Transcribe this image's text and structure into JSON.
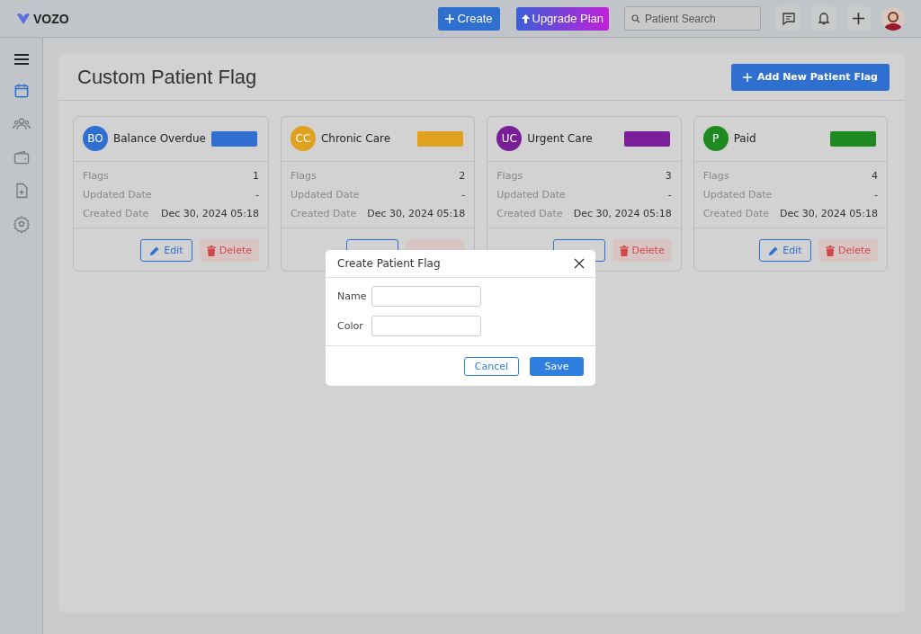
{
  "topbar": {
    "logo": "VOZO",
    "create": "Create",
    "upgrade": "Upgrade Plan",
    "search": {
      "placeholder": "Patient Search"
    }
  },
  "sidebar": {
    "items": [
      {
        "selected": true
      },
      {
        "selected": false
      },
      {
        "selected": false
      },
      {
        "selected": false
      },
      {
        "selected": false
      }
    ]
  },
  "page": {
    "title": "Custom Patient Flag",
    "add_button": "Add New Patient Flag"
  },
  "cards": [
    {
      "initials": "BO",
      "name": "Balance Overdue",
      "color": "#2f6fd0",
      "rows": [
        {
          "label": "Flags",
          "value": "1"
        },
        {
          "label": "Updated Date",
          "value": "-"
        },
        {
          "label": "Created Date",
          "value": "Dec 30, 2024 05:18"
        }
      ],
      "edit": "Edit",
      "delete": "Delete"
    },
    {
      "initials": "CC",
      "name": "Chronic Care",
      "color": "#e0a020",
      "rows": [
        {
          "label": "Flags",
          "value": "2"
        },
        {
          "label": "Updated Date",
          "value": "-"
        },
        {
          "label": "Created Date",
          "value": "Dec 30, 2024 05:18"
        }
      ]
    },
    {
      "initials": "UC",
      "name": "Urgent Care",
      "color": "#7a1f9a",
      "rows": [
        {
          "label": "Flags",
          "value": "3"
        },
        {
          "label": "Updated Date",
          "value": "-"
        },
        {
          "label": "Created Date",
          "value": "Dec 30, 2024 05:18"
        }
      ],
      "delete": "Delete"
    },
    {
      "initials": "P",
      "name": "Paid",
      "color": "#1f8a1f",
      "rows": [
        {
          "label": "Flags",
          "value": "4"
        },
        {
          "label": "Updated Date",
          "value": "-"
        },
        {
          "label": "Created Date",
          "value": "Dec 30, 2024 05:18"
        }
      ],
      "edit": "Edit",
      "delete": "Delete"
    }
  ],
  "dialog": {
    "title": "Create Patient Flag",
    "fields": [
      {
        "label": "Name"
      },
      {
        "label": "Color"
      }
    ],
    "cancel": "Cancel",
    "save": "Save"
  }
}
